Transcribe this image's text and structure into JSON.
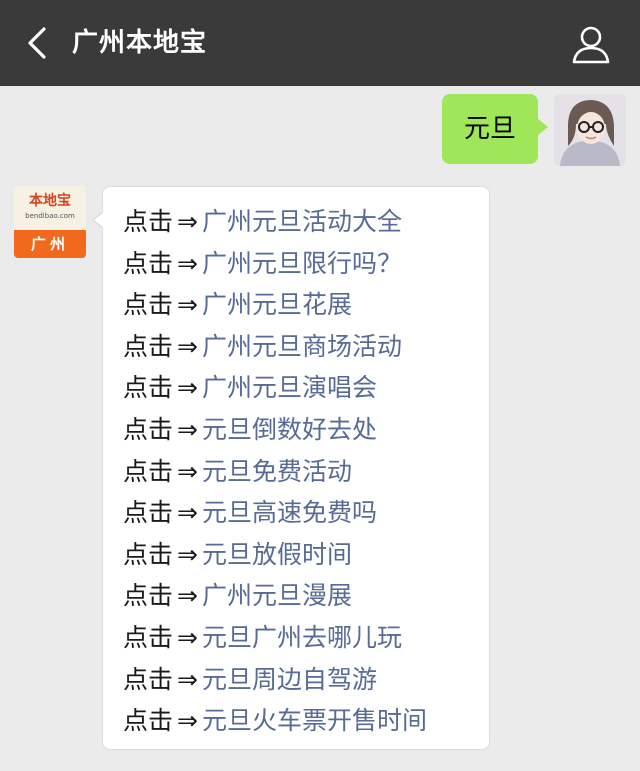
{
  "header": {
    "title": "广州本地宝",
    "back_icon": "chevron-left-icon",
    "profile_icon": "person-icon"
  },
  "colors": {
    "topbar": "#3a3a3a",
    "background": "#ebebeb",
    "outgoing_bubble": "#9fe658",
    "incoming_bubble": "#ffffff",
    "link_text": "#576b95",
    "logo_orange": "#f0691d"
  },
  "messages": {
    "outgoing": {
      "text": "元旦"
    },
    "sender_logo": {
      "brand": "本地宝",
      "domain": "bendibao.com",
      "city": "广州"
    },
    "incoming": {
      "prefix": "点击",
      "arrow": "⇒",
      "links": [
        "广州元旦活动大全",
        "广州元旦限行吗？",
        "广州元旦花展",
        "广州元旦商场活动",
        "广州元旦演唱会",
        "元旦倒数好去处",
        "元旦免费活动",
        "元旦高速免费吗",
        "元旦放假时间",
        "广州元旦漫展",
        "元旦广州去哪儿玩",
        "元旦周边自驾游",
        "元旦火车票开售时间"
      ]
    }
  }
}
